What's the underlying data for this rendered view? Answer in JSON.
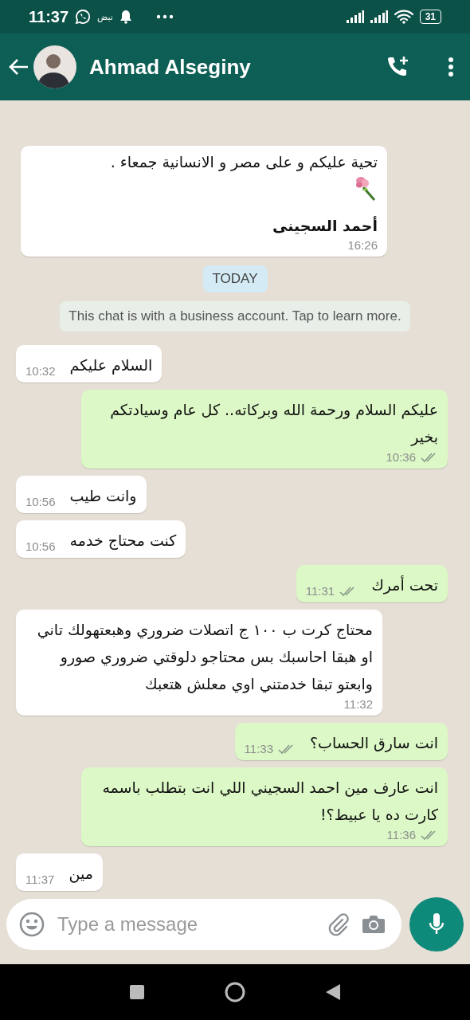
{
  "status_bar": {
    "time": "11:37",
    "carrier_note": "نبض",
    "battery": "31"
  },
  "header": {
    "contact_name": "Ahmad Alseginy"
  },
  "messages": [
    {
      "kind": "incoming",
      "parts": [
        {
          "kind": "text",
          "text": "تحية عليكم و على مصر و الانسانية جمعاء ."
        },
        {
          "kind": "bouquet"
        },
        {
          "kind": "text",
          "text": "أحمد السجينى"
        }
      ],
      "time": "16:26"
    },
    {
      "kind": "date",
      "text": "TODAY"
    },
    {
      "kind": "notice",
      "text": "This chat is with a business account. Tap to learn more."
    },
    {
      "kind": "incoming",
      "text": "السلام عليكم",
      "time": "10:32"
    },
    {
      "kind": "outgoing",
      "text": "عليكم السلام ورحمة الله وبركاته.. كل عام وسيادتكم بخير",
      "time": "10:36"
    },
    {
      "kind": "incoming",
      "text": "وانت طيب",
      "time": "10:56"
    },
    {
      "kind": "incoming",
      "text": "كنت محتاج خدمه",
      "time": "10:56"
    },
    {
      "kind": "outgoing",
      "text": "تحت أمرك",
      "time": "11:31"
    },
    {
      "kind": "incoming",
      "text": "محتاج كرت ب ١٠٠ ج اتصلات ضروري وهبعتهولك تاني او هبقا احاسبك بس محتاجو دلوقتي ضروري صورو وابعتو تبقا خدمتني اوي معلش هتعبك",
      "time": "11:32"
    },
    {
      "kind": "outgoing",
      "text": "انت سارق الحساب؟",
      "time": "11:33"
    },
    {
      "kind": "outgoing",
      "text": "انت عارف مين احمد السجيني اللي انت بتطلب باسمه كارت ده يا عبيط؟!",
      "time": "11:36"
    },
    {
      "kind": "incoming",
      "text": "مين",
      "time": "11:37"
    }
  ],
  "composer": {
    "placeholder": "Type a message"
  }
}
